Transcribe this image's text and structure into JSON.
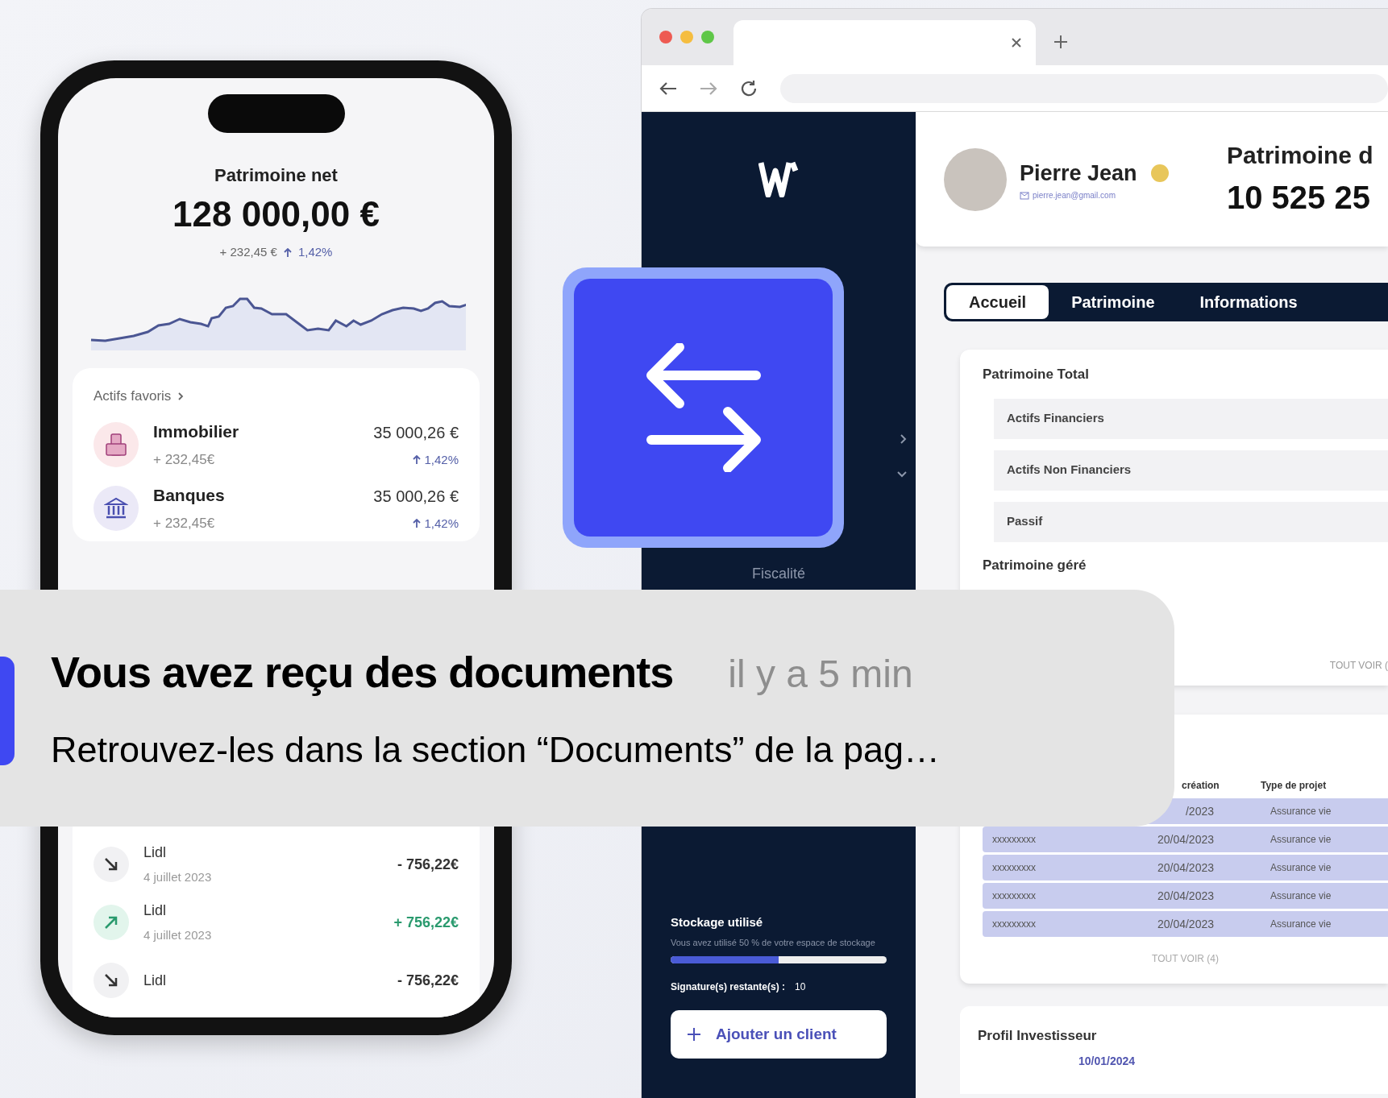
{
  "phone": {
    "title": "Patrimoine net",
    "amount": "128 000,00 €",
    "change": "+ 232,45 €",
    "change_pct": "1,42%",
    "favorites": {
      "title": "Actifs favoris",
      "items": [
        {
          "kind": "building",
          "name": "Immobilier",
          "change": "+ 232,45€",
          "value": "35 000,26 €",
          "pct": "1,42%"
        },
        {
          "kind": "bank",
          "name": "Banques",
          "change": "+ 232,45€",
          "value": "35 000,26 €",
          "pct": "1,42%"
        }
      ]
    },
    "transactions": [
      {
        "kind": "out",
        "name": "Lidl",
        "date": "4 juillet 2023",
        "amount": "- 756,22€"
      },
      {
        "kind": "in",
        "name": "Lidl",
        "date": "4 juillet 2023",
        "amount": "+ 756,22€"
      },
      {
        "kind": "out",
        "name": "Lidl",
        "amount": "- 756,22€"
      }
    ]
  },
  "browser": {
    "sidebar": {
      "items": [
        "Fiscalité"
      ],
      "storage": {
        "title": "Stockage utilisé",
        "description": "Vous avez utilisé 50 % de votre espace de stockage",
        "level": 0.5
      },
      "signatures_label": "Signature(s) restante(s) :",
      "signatures_value": "10",
      "add_button": "Ajouter un client"
    },
    "profile": {
      "name": "Pierre Jean",
      "email": "pierre.jean@gmail.com"
    },
    "header": {
      "title": "Patrimoine d",
      "amount": "10 525 25"
    },
    "tabs": [
      {
        "label": "Accueil",
        "selected": true
      },
      {
        "label": "Patrimoine",
        "selected": false
      },
      {
        "label": "Informations",
        "selected": false
      }
    ],
    "total_card": {
      "title": "Patrimoine Total",
      "rows": [
        "Actifs Financiers",
        "Actifs Non Financiers",
        "Passif"
      ],
      "managed_title": "Patrimoine géré",
      "link": "TOUT VOIR ("
    },
    "table": {
      "columns": [
        "création",
        "Type de projet"
      ],
      "rows": [
        {
          "date": "/2023",
          "type": "Assurance vie"
        },
        {
          "client": "xxxxxxxxx",
          "date": "20/04/2023",
          "type": "Assurance vie"
        },
        {
          "client": "xxxxxxxxx",
          "date": "20/04/2023",
          "type": "Assurance vie"
        },
        {
          "client": "xxxxxxxxx",
          "date": "20/04/2023",
          "type": "Assurance vie"
        },
        {
          "client": "xxxxxxxxx",
          "date": "20/04/2023",
          "type": "Assurance vie"
        }
      ],
      "link": "TOUT VOIR (4)"
    },
    "investor": {
      "title": "Profil Investisseur",
      "date": "10/01/2024"
    }
  },
  "notification": {
    "title": "Vous avez reçu des documents",
    "time": "il y a 5 min",
    "body": "Retrouvez-les dans la section “Documents” de la pag…"
  }
}
